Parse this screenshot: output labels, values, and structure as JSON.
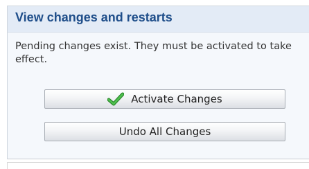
{
  "panel": {
    "title": "View changes and restarts",
    "message": "Pending changes exist. They must be activated to take effect.",
    "buttons": {
      "activate_label": "Activate Changes",
      "undo_label": "Undo All Changes"
    }
  },
  "icons": {
    "activate_icon": "check-icon"
  },
  "colors": {
    "title_text": "#1f4e8a",
    "header_bg": "#e3ebf6",
    "panel_bg": "#f5f8fc",
    "check_green": "#3aa43a"
  }
}
